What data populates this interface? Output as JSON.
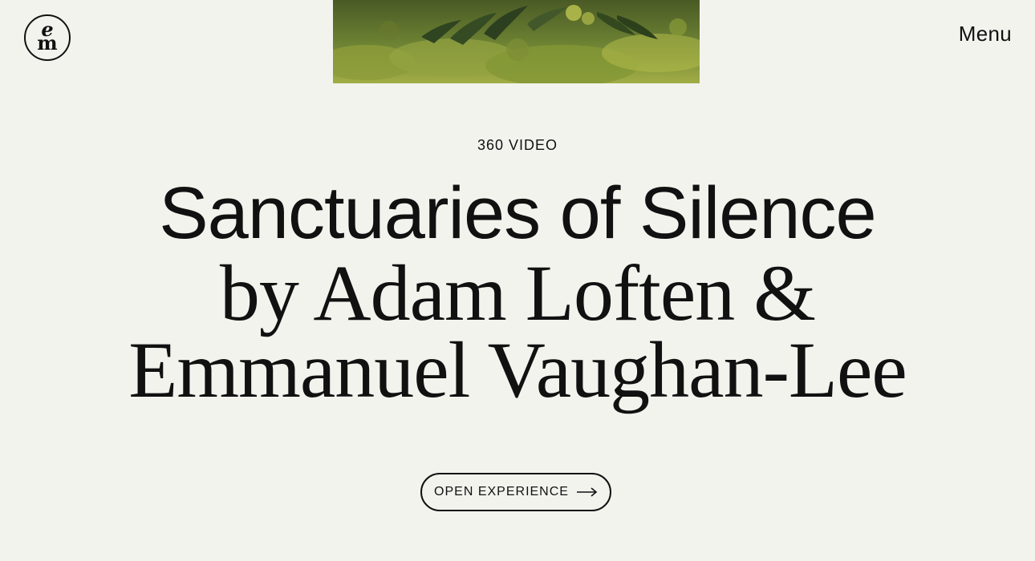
{
  "header": {
    "logo": {
      "top_letter": "e",
      "bottom_letter": "m"
    },
    "menu_label": "Menu"
  },
  "hero": {
    "image_alt_icon": "forest-moss-image",
    "kicker": "360 VIDEO",
    "title_lines": [
      "Sanctuaries of Silence",
      "by Adam Loften &",
      "Emmanuel Vaughan-Lee"
    ],
    "cta_label": "OPEN EXPERIENCE",
    "cta_icon": "arrow-right-icon"
  },
  "colors": {
    "background": "#f3f3ee",
    "text": "#111111",
    "moss": "#6f8434"
  }
}
